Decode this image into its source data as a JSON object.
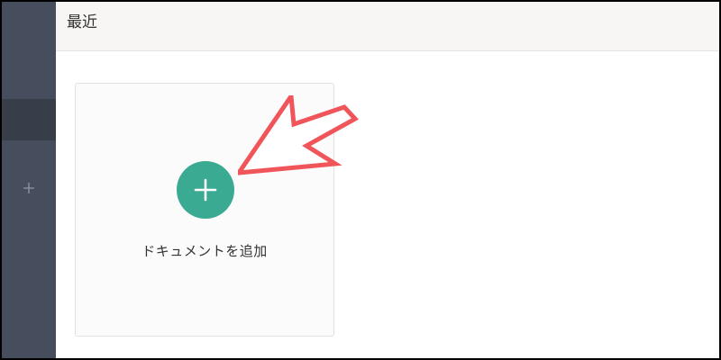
{
  "header": {
    "title": "最近"
  },
  "sidebar": {
    "add_icon": "plus-icon"
  },
  "main": {
    "add_document": {
      "label": "ドキュメントを追加",
      "icon": "plus-icon"
    }
  },
  "annotation": {
    "icon": "arrow-pointer-icon",
    "color": "#f0555a"
  },
  "colors": {
    "sidebar": "#464e5d",
    "sidebar_active": "#373e4a",
    "accent": "#3aaa93",
    "header_bg": "#f7f6f4"
  }
}
